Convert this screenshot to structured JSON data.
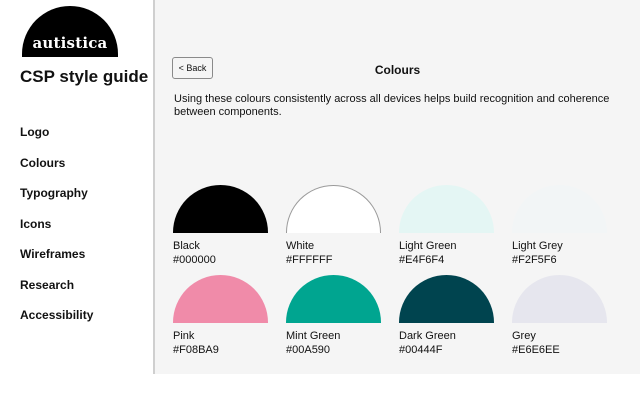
{
  "brand": {
    "logo_text": "autistica"
  },
  "sidebar": {
    "title": "CSP style guide",
    "items": [
      {
        "label": "Logo",
        "name": "sidebar-item-logo"
      },
      {
        "label": "Colours",
        "name": "sidebar-item-colours"
      },
      {
        "label": "Typography",
        "name": "sidebar-item-typography"
      },
      {
        "label": "Icons",
        "name": "sidebar-item-icons"
      },
      {
        "label": "Wireframes",
        "name": "sidebar-item-wireframes"
      },
      {
        "label": "Research",
        "name": "sidebar-item-research"
      },
      {
        "label": "Accessibility",
        "name": "sidebar-item-accessibility"
      }
    ]
  },
  "main": {
    "back_label": "< Back",
    "title": "Colours",
    "intro": "Using these colours consistently across all devices helps build recognition and coherence between components.",
    "swatches": [
      {
        "name": "Black",
        "hex": "#000000",
        "color": "#000000",
        "outline": false
      },
      {
        "name": "White",
        "hex": "#FFFFFF",
        "color": "#FFFFFF",
        "outline": true
      },
      {
        "name": "Light Green",
        "hex": "#E4F6F4",
        "color": "#E4F6F4",
        "outline": false
      },
      {
        "name": "Light Grey",
        "hex": "#F2F5F6",
        "color": "#F2F5F6",
        "outline": false
      },
      {
        "name": "Pink",
        "hex": "#F08BA9",
        "color": "#F08BA9",
        "outline": false
      },
      {
        "name": "Mint Green",
        "hex": "#00A590",
        "color": "#00A590",
        "outline": false
      },
      {
        "name": "Dark Green",
        "hex": "#00444F",
        "color": "#00444F",
        "outline": false
      },
      {
        "name": "Grey",
        "hex": "#E6E6EE",
        "color": "#E6E6EE",
        "outline": false
      }
    ]
  }
}
